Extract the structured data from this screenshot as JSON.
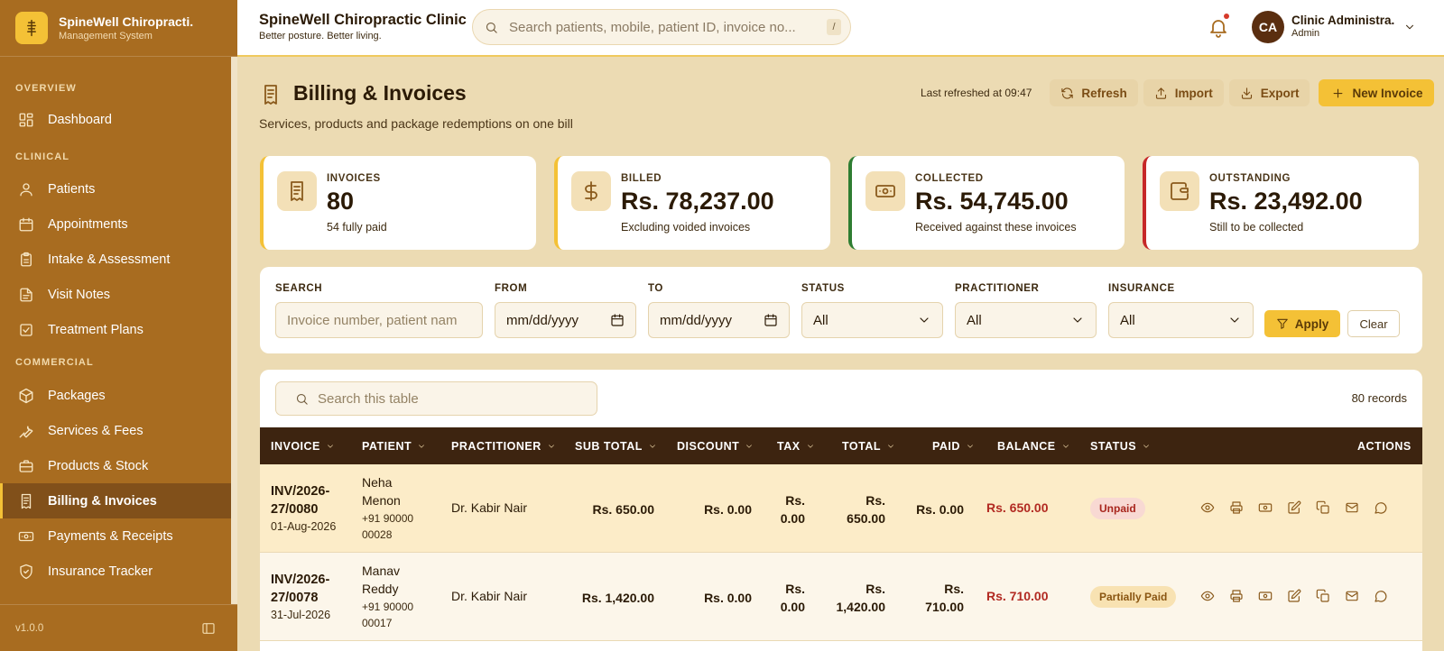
{
  "sidebar": {
    "brand_title": "SpineWell Chiropracti.",
    "brand_subtitle": "Management System",
    "sections": {
      "overview": "OVERVIEW",
      "clinical": "CLINICAL",
      "commercial": "COMMERCIAL"
    },
    "items": [
      {
        "label": "Dashboard",
        "icon": "grid-icon"
      },
      {
        "label": "Patients",
        "icon": "user-icon"
      },
      {
        "label": "Appointments",
        "icon": "calendar-icon"
      },
      {
        "label": "Intake & Assessment",
        "icon": "clipboard-icon"
      },
      {
        "label": "Visit Notes",
        "icon": "document-icon"
      },
      {
        "label": "Treatment Plans",
        "icon": "checklist-icon"
      },
      {
        "label": "Packages",
        "icon": "box-icon"
      },
      {
        "label": "Services & Fees",
        "icon": "wrench-icon"
      },
      {
        "label": "Products & Stock",
        "icon": "briefcase-icon"
      },
      {
        "label": "Billing & Invoices",
        "icon": "receipt-icon",
        "active": true
      },
      {
        "label": "Payments & Receipts",
        "icon": "cash-icon"
      },
      {
        "label": "Insurance Tracker",
        "icon": "shield-icon"
      }
    ],
    "version": "v1.0.0"
  },
  "topbar": {
    "clinic_name": "SpineWell Chiropractic Clinic",
    "tagline": "Better posture. Better living.",
    "search_placeholder": "Search patients, mobile, patient ID, invoice no...",
    "search_shortcut": "/",
    "avatar_initials": "CA",
    "user_name": "Clinic Administra.",
    "user_role": "Admin"
  },
  "header": {
    "title": "Billing & Invoices",
    "subtitle": "Services, products and package redemptions on one bill",
    "last_refreshed": "Last refreshed at 09:47",
    "refresh_label": "Refresh",
    "import_label": "Import",
    "export_label": "Export",
    "new_invoice_label": "New Invoice"
  },
  "stats": [
    {
      "label": "INVOICES",
      "value": "80",
      "note": "54 fully paid",
      "accent": "#f4c136"
    },
    {
      "label": "BILLED",
      "value": "Rs. 78,237.00",
      "note": "Excluding voided invoices",
      "accent": "#f4c136"
    },
    {
      "label": "COLLECTED",
      "value": "Rs. 54,745.00",
      "note": "Received against these invoices",
      "accent": "#2e7d32"
    },
    {
      "label": "OUTSTANDING",
      "value": "Rs. 23,492.00",
      "note": "Still to be collected",
      "accent": "#c62828"
    }
  ],
  "filters": {
    "search_label": "SEARCH",
    "search_placeholder": "Invoice number, patient nam",
    "from_label": "FROM",
    "from_value": "mm/dd/yyyy",
    "to_label": "TO",
    "to_value": "mm/dd/yyyy",
    "status_label": "STATUS",
    "status_value": "All",
    "practitioner_label": "PRACTITIONER",
    "practitioner_value": "All",
    "insurance_label": "INSURANCE",
    "insurance_value": "All",
    "apply_label": "Apply",
    "clear_label": "Clear"
  },
  "table": {
    "search_placeholder": "Search this table",
    "record_count": "80 records",
    "columns": [
      "INVOICE",
      "PATIENT",
      "PRACTITIONER",
      "SUB TOTAL",
      "DISCOUNT",
      "TAX",
      "TOTAL",
      "PAID",
      "BALANCE",
      "STATUS",
      "ACTIONS"
    ],
    "rows": [
      {
        "invoice_no_1": "INV/2026-",
        "invoice_no_2": "27/0080",
        "date": "01-Aug-2026",
        "patient_1": "Neha",
        "patient_2": "Menon",
        "mobile_1": "+91 90000",
        "mobile_2": "00028",
        "practitioner": "Dr. Kabir Nair",
        "sub_total": "Rs. 650.00",
        "discount": "Rs. 0.00",
        "tax_1": "Rs.",
        "tax_2": "0.00",
        "total_1": "Rs.",
        "total_2": "650.00",
        "paid": "Rs. 0.00",
        "balance": "Rs. 650.00",
        "status": "Unpaid"
      },
      {
        "invoice_no_1": "INV/2026-",
        "invoice_no_2": "27/0078",
        "date": "31-Jul-2026",
        "patient_1": "Manav",
        "patient_2": "Reddy",
        "mobile_1": "+91 90000",
        "mobile_2": "00017",
        "practitioner": "Dr. Kabir Nair",
        "sub_total": "Rs. 1,420.00",
        "discount": "Rs. 0.00",
        "tax_1": "Rs.",
        "tax_2": "0.00",
        "total_1": "Rs.",
        "total_2": "1,420.00",
        "paid_1": "Rs.",
        "paid_2": "710.00",
        "balance": "Rs. 710.00",
        "status": "Partially Paid"
      }
    ],
    "row_actions": [
      "eye-icon",
      "printer-icon",
      "cash-icon",
      "edit-icon",
      "copy-icon",
      "mail-icon",
      "whatsapp-icon"
    ]
  }
}
